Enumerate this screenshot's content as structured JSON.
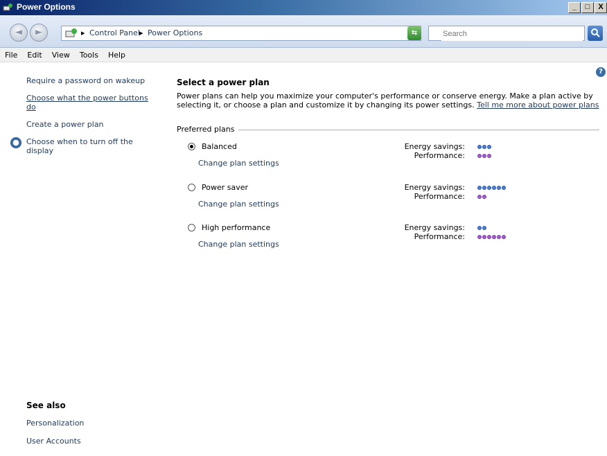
{
  "window": {
    "title": "Power Options",
    "min_label": "_",
    "max_label": "□",
    "close_label": "X"
  },
  "address": {
    "crumbs": [
      "Control Panel",
      "Power Options"
    ],
    "separator": "▸",
    "search_placeholder": "Search"
  },
  "menu": [
    "File",
    "Edit",
    "View",
    "Tools",
    "Help"
  ],
  "sidebar": {
    "links": [
      "Require a password on wakeup",
      "Choose what the power buttons do",
      "Create a power plan",
      "Choose when to turn off the display"
    ],
    "see_also_title": "See also",
    "see_also_links": [
      "Personalization",
      "User Accounts"
    ]
  },
  "main": {
    "heading": "Select a power plan",
    "description": "Power plans can help you maximize your computer's performance or conserve energy. Make a plan active by selecting it, or choose a plan and customize it by changing its power settings.",
    "learn_more": "Tell me more about power plans",
    "group_label": "Preferred plans",
    "energy_label": "Energy savings:",
    "performance_label": "Performance:",
    "change_link": "Change plan settings",
    "plans": [
      {
        "name": "Balanced",
        "selected": true,
        "energy_savings": 3,
        "performance": 3
      },
      {
        "name": "Power saver",
        "selected": false,
        "energy_savings": 6,
        "performance": 2
      },
      {
        "name": "High performance",
        "selected": false,
        "energy_savings": 2,
        "performance": 6
      }
    ]
  },
  "colors": {
    "energy_dot": "#4e7fd8",
    "performance_dot": "#a35fd0",
    "link": "#1e395b"
  }
}
